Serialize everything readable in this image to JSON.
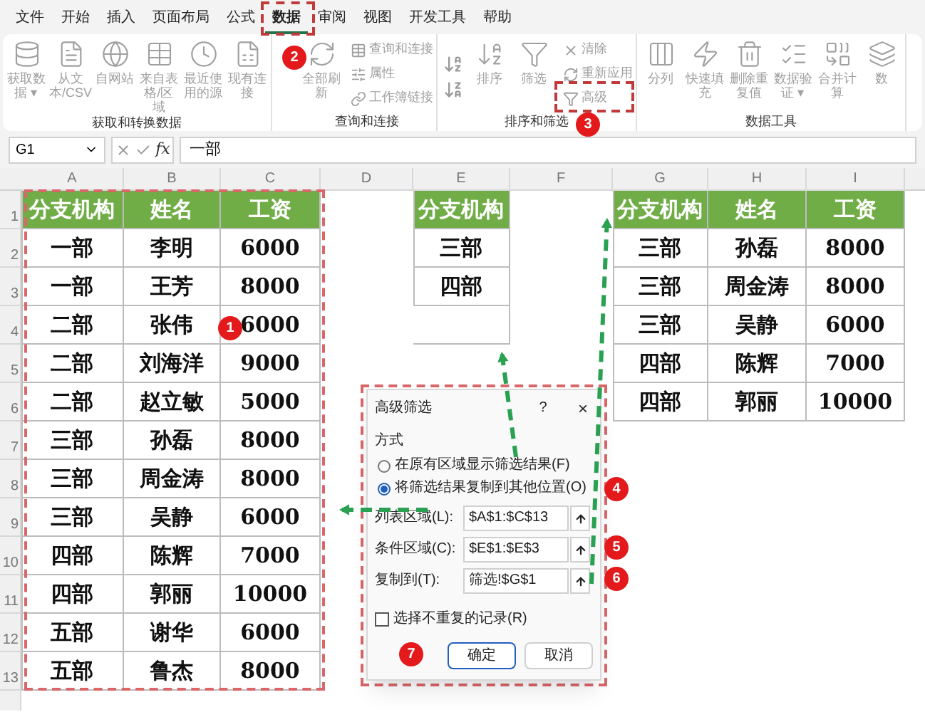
{
  "menu_tabs": [
    {
      "label": "文件",
      "selected": false
    },
    {
      "label": "开始",
      "selected": false
    },
    {
      "label": "插入",
      "selected": false
    },
    {
      "label": "页面布局",
      "selected": false
    },
    {
      "label": "公式",
      "selected": false
    },
    {
      "label": "数据",
      "selected": true
    },
    {
      "label": "审阅",
      "selected": false
    },
    {
      "label": "视图",
      "selected": false
    },
    {
      "label": "开发工具",
      "selected": false
    },
    {
      "label": "帮助",
      "selected": false
    }
  ],
  "ribbon": [
    {
      "label": "获取和转换数据",
      "large": [
        {
          "label": "获取数据 ▾",
          "disabled": true
        },
        {
          "label": "从文本/CSV",
          "disabled": true
        },
        {
          "label": "自网站",
          "disabled": true
        },
        {
          "label": "来自表格/区域",
          "disabled": true
        },
        {
          "label": "最近使用的源",
          "disabled": true
        },
        {
          "label": "现有连接",
          "disabled": true
        }
      ]
    },
    {
      "label": "查询和连接",
      "large": [
        {
          "label": "全部刷新",
          "disabled": true
        }
      ],
      "small": [
        {
          "label": "查询和连接",
          "disabled": true
        },
        {
          "label": "属性",
          "disabled": true
        },
        {
          "label": "工作簿链接",
          "disabled": true
        }
      ]
    },
    {
      "label": "排序和筛选",
      "large": [
        {
          "label": "排序",
          "disabled": true
        },
        {
          "label": "筛选",
          "disabled": true
        }
      ],
      "small": [
        {
          "label": "清除",
          "disabled": true
        },
        {
          "label": "重新应用",
          "disabled": true
        },
        {
          "label": "高级",
          "disabled": true
        }
      ]
    },
    {
      "label": "数据工具",
      "large": [
        {
          "label": "分列",
          "disabled": true
        },
        {
          "label": "快速填充",
          "disabled": true
        },
        {
          "label": "删除重复值",
          "disabled": true
        },
        {
          "label": "数据验证 ▾",
          "disabled": true
        },
        {
          "label": "合并计算",
          "disabled": true
        },
        {
          "label": "数",
          "disabled": true
        }
      ]
    }
  ],
  "formula_bar": {
    "name_box": "G1",
    "fx": "fx",
    "value": "一部"
  },
  "column_headers": [
    "A",
    "B",
    "C",
    "D",
    "E",
    "F",
    "G",
    "H",
    "I"
  ],
  "row_numbers": [
    "1",
    "2",
    "3",
    "4",
    "5",
    "6",
    "7",
    "8",
    "9",
    "10",
    "11",
    "12",
    "13"
  ],
  "source_table": {
    "columns": [
      "分支机构",
      "姓名",
      "工资"
    ],
    "rows": [
      [
        "一部",
        "李明",
        "6000"
      ],
      [
        "一部",
        "王芳",
        "8000"
      ],
      [
        "二部",
        "张伟",
        "6000"
      ],
      [
        "二部",
        "刘海洋",
        "9000"
      ],
      [
        "二部",
        "赵立敏",
        "5000"
      ],
      [
        "三部",
        "孙磊",
        "8000"
      ],
      [
        "三部",
        "周金涛",
        "8000"
      ],
      [
        "三部",
        "吴静",
        "6000"
      ],
      [
        "四部",
        "陈辉",
        "7000"
      ],
      [
        "四部",
        "郭丽",
        "10000"
      ],
      [
        "五部",
        "谢华",
        "6000"
      ],
      [
        "五部",
        "鲁杰",
        "8000"
      ]
    ]
  },
  "criteria_table": {
    "columns": [
      "分支机构"
    ],
    "rows": [
      [
        "三部"
      ],
      [
        "四部"
      ]
    ]
  },
  "result_table": {
    "columns": [
      "分支机构",
      "姓名",
      "工资"
    ],
    "rows": [
      [
        "三部",
        "孙磊",
        "8000"
      ],
      [
        "三部",
        "周金涛",
        "8000"
      ],
      [
        "三部",
        "吴静",
        "6000"
      ],
      [
        "四部",
        "陈辉",
        "7000"
      ],
      [
        "四部",
        "郭丽",
        "10000"
      ]
    ]
  },
  "dialog": {
    "title": "高级筛选",
    "help": "?",
    "close": "×",
    "section": "方式",
    "options": [
      {
        "label": "在原有区域显示筛选结果(F)",
        "selected": false
      },
      {
        "label": "将筛选结果复制到其他位置(O)",
        "selected": true
      }
    ],
    "fields": [
      {
        "label": "列表区域(L):",
        "value": "$A$1:$C$13"
      },
      {
        "label": "条件区域(C):",
        "value": "$E$1:$E$3"
      },
      {
        "label": "复制到(T):",
        "value": "筛选!$G$1"
      }
    ],
    "unique_only": {
      "label": "选择不重复的记录(R)",
      "checked": false
    },
    "buttons": [
      "确定",
      "取消"
    ]
  },
  "badges": [
    "1",
    "2",
    "3",
    "4",
    "5",
    "6",
    "7"
  ]
}
